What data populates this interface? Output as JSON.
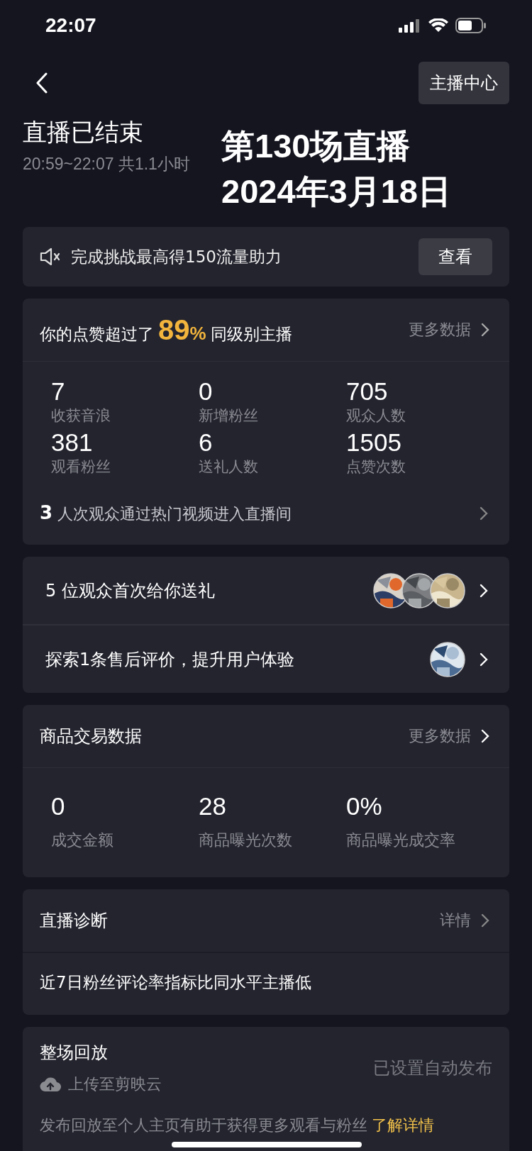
{
  "status_bar": {
    "time": "22:07"
  },
  "header": {
    "button": "主播中心",
    "title": "直播已结束",
    "subtitle": "20:59~22:07 共1.1小时",
    "overlay": [
      "第130场直播",
      "2024年3月18日"
    ]
  },
  "challenge": {
    "text": "完成挑战最高得150流量助力",
    "button": "查看"
  },
  "likes_card": {
    "prefix": "你的点赞超过了",
    "percent": "89",
    "percent_unit": "%",
    "suffix": "同级别主播",
    "more": "更多数据",
    "stats": [
      {
        "value": "7",
        "label": "收获音浪"
      },
      {
        "value": "0",
        "label": "新增粉丝"
      },
      {
        "value": "705",
        "label": "观众人数"
      },
      {
        "value": "381",
        "label": "观看粉丝"
      },
      {
        "value": "6",
        "label": "送礼人数"
      },
      {
        "value": "1505",
        "label": "点赞次数"
      }
    ],
    "hot_row": "**3** 人次观众通过热门视频进入直播间"
  },
  "notice_rows": [
    {
      "text": "5 位观众首次给你送礼"
    },
    {
      "text": "探索1条售后评价，提升用户体验"
    }
  ],
  "product_card": {
    "title": "商品交易数据",
    "more": "更多数据",
    "stats": [
      {
        "value": "0",
        "label": "成交金额"
      },
      {
        "value": "28",
        "label": "商品曝光次数"
      },
      {
        "value": "0%",
        "label": "商品曝光成交率"
      }
    ]
  },
  "diagnosis_card": {
    "title": "直播诊断",
    "more": "详情",
    "text": "近7日粉丝评论率指标比同水平主播低"
  },
  "replay_card": {
    "title": "整场回放",
    "upload": "上传至剪映云",
    "status": "已设置自动发布",
    "note": "发布回放至个人主页有助于获得更多观看与粉丝",
    "link": "了解详情"
  }
}
